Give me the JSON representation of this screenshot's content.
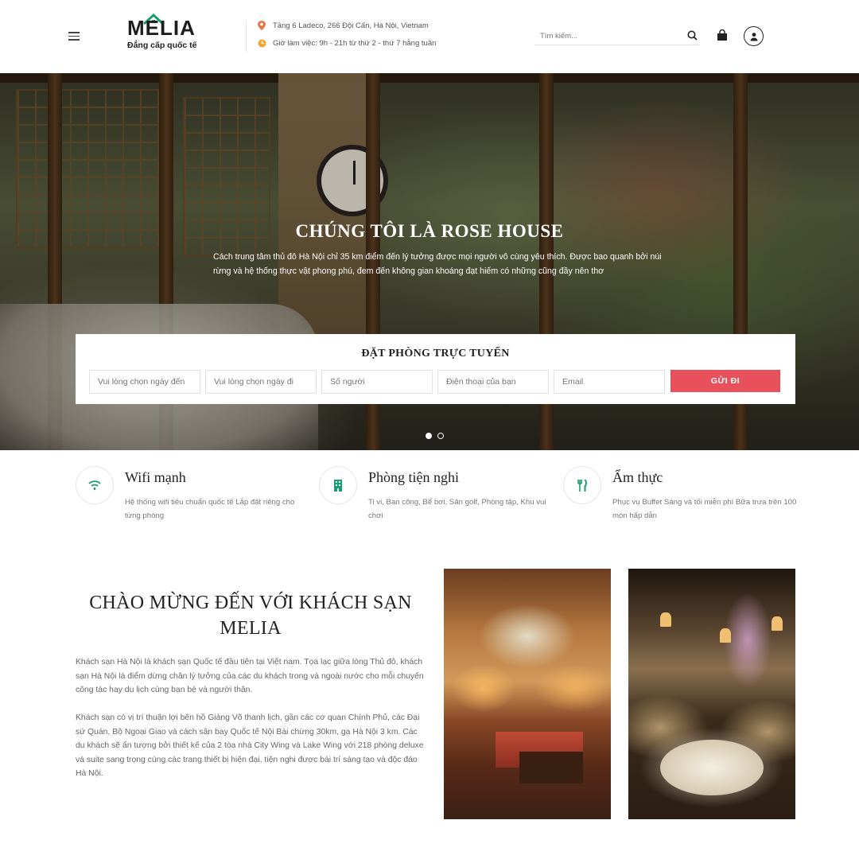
{
  "header": {
    "logo_text": "MELIA",
    "logo_tagline": "Đẳng cấp quốc tế",
    "address": "Tầng 6 Ladeco, 266 Đội Cấn, Hà Nội, Vietnam",
    "hours": "Giờ làm việc: 9h - 21h từ thứ 2 - thứ 7 hằng tuần",
    "search_placeholder": "Tìm kiếm...",
    "accent_color": "#1a9b73"
  },
  "hero": {
    "title": "CHÚNG TÔI LÀ ROSE HOUSE",
    "description": "Cách trung tâm thủ đô Hà Nội chỉ 35 km điểm đến lý tưởng được mọi người vô cùng yêu thích. Được bao quanh bởi núi rừng và hệ thống thực vật phong phú, đem đến không gian khoáng đạt hiếm có những cũng đầy nên thơ",
    "slides_count": 2,
    "active_slide": 1
  },
  "booking": {
    "title": "ĐẶT PHÒNG TRỰC TUYẾN",
    "fields": [
      {
        "placeholder": "Vui lòng chọn ngày đến"
      },
      {
        "placeholder": "Vui lòng chọn ngày đi"
      },
      {
        "placeholder": "Số người"
      },
      {
        "placeholder": "Điện thoại của bạn"
      },
      {
        "placeholder": "Email"
      }
    ],
    "submit_label": "GỬI ĐI",
    "submit_color": "#e8505b"
  },
  "features": [
    {
      "icon": "wifi-icon",
      "title": "Wifi mạnh",
      "description": "Hệ thống wifi tiêu chuẩn quốc tế Lắp đặt riêng cho từng phòng"
    },
    {
      "icon": "building-icon",
      "title": "Phòng tiện nghi",
      "description": "Ti vi, Ban công, Bể bơi, Sân golf, Phòng tập, Khu vui chơi"
    },
    {
      "icon": "cutlery-icon",
      "title": "Ẩm thực",
      "description": "Phục vụ Buffet Sáng và tối miễn phí Bữa trưa trên 100 món hấp dẫn"
    }
  ],
  "welcome": {
    "title": "CHÀO MỪNG ĐẾN VỚI KHÁCH SẠN MELIA",
    "paragraph1": "Khách sạn Hà Nội là khách sạn Quốc tế đầu tiên tại Việt nam. Tọa lạc giữa lòng Thủ đô, khách sạn Hà Nội là điểm dừng chân lý tưởng của các du khách trong và ngoài nước cho mỗi chuyến công tác hay du lịch cùng bạn bè và người thân.",
    "paragraph2": "Khách sạn có vị trí thuận lợi bên hồ Giảng Võ thanh lịch, gần các cơ quan Chính Phủ, các Đại sứ Quán, Bộ Ngoại Giao và cách sân bay Quốc tế Nội Bài chừng 30km, ga Hà Nội 3 km. Các du khách sẽ ấn tượng bởi thiết kế của 2 tòa nhà City Wing và Lake Wing với 218 phòng deluxe và suite sang trọng cùng các trang thiết bị hiện đại, tiện nghi được bài trí sáng tạo và độc đáo Hà Nội."
  }
}
